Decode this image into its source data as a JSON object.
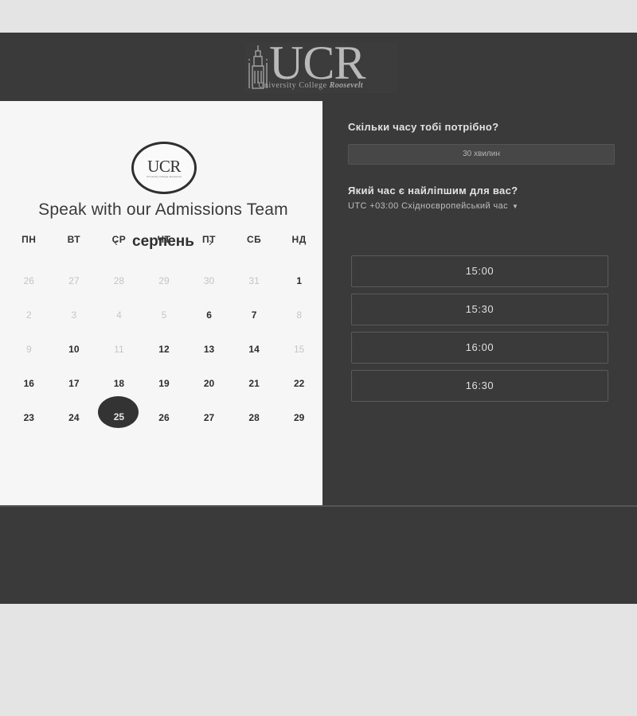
{
  "header": {
    "logo_text": "UCR",
    "logo_tagline": "University College",
    "logo_tagline_italic": "Roosevelt"
  },
  "calendar": {
    "badge_text": "UCR",
    "badge_sub": "University College Roosevelt",
    "title": "Speak with our Admissions Team",
    "month": "серпень",
    "prev_icon": "chevron-left-icon",
    "next_icon": "chevron-right-icon",
    "weekdays": [
      "ПН",
      "ВТ",
      "СР",
      "ЧТ",
      "ПТ",
      "СБ",
      "НД"
    ],
    "weeks": [
      [
        {
          "d": "26",
          "s": "off"
        },
        {
          "d": "27",
          "s": "off"
        },
        {
          "d": "28",
          "s": "off"
        },
        {
          "d": "29",
          "s": "off"
        },
        {
          "d": "30",
          "s": "off"
        },
        {
          "d": "31",
          "s": "off"
        },
        {
          "d": "1",
          "s": "ok"
        }
      ],
      [
        {
          "d": "2",
          "s": "na"
        },
        {
          "d": "3",
          "s": "na"
        },
        {
          "d": "4",
          "s": "na"
        },
        {
          "d": "5",
          "s": "na"
        },
        {
          "d": "6",
          "s": "ok"
        },
        {
          "d": "7",
          "s": "ok"
        },
        {
          "d": "8",
          "s": "na"
        }
      ],
      [
        {
          "d": "9",
          "s": "na"
        },
        {
          "d": "10",
          "s": "ok"
        },
        {
          "d": "11",
          "s": "na"
        },
        {
          "d": "12",
          "s": "ok"
        },
        {
          "d": "13",
          "s": "ok"
        },
        {
          "d": "14",
          "s": "ok"
        },
        {
          "d": "15",
          "s": "na"
        }
      ],
      [
        {
          "d": "16",
          "s": "ok"
        },
        {
          "d": "17",
          "s": "ok"
        },
        {
          "d": "18",
          "s": "ok"
        },
        {
          "d": "19",
          "s": "ok"
        },
        {
          "d": "20",
          "s": "ok"
        },
        {
          "d": "21",
          "s": "ok"
        },
        {
          "d": "22",
          "s": "ok"
        }
      ],
      [
        {
          "d": "23",
          "s": "ok"
        },
        {
          "d": "24",
          "s": "ok"
        },
        {
          "d": "25",
          "s": "sel"
        },
        {
          "d": "26",
          "s": "ok"
        },
        {
          "d": "27",
          "s": "ok"
        },
        {
          "d": "28",
          "s": "ok"
        },
        {
          "d": "29",
          "s": "ok"
        }
      ]
    ]
  },
  "booking": {
    "duration_question": "Скільки часу тобі потрібно?",
    "duration_value": "30 хвилин",
    "time_question": "Який час є найліпшим для вас?",
    "timezone": "UTC +03:00 Східноєвропейський час",
    "timezone_caret": "▼",
    "slots": [
      "15:00",
      "15:30",
      "16:00",
      "16:30"
    ]
  },
  "colors": {
    "dark_bg": "#3a3a3a",
    "calendar_bg": "#f6f6f6",
    "page_bg": "#e4e4e4",
    "selected_day": "#333333"
  }
}
